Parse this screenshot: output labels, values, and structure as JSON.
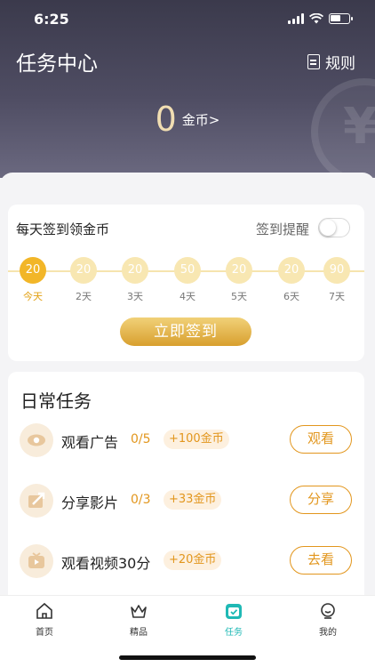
{
  "status": {
    "time": "6:25"
  },
  "header": {
    "title": "任务中心",
    "rules_label": "规则"
  },
  "balance": {
    "value": "0",
    "unit": "金币>"
  },
  "checkin": {
    "title": "每天签到领金币",
    "reminder_label": "签到提醒",
    "reminder_enabled": false,
    "days": [
      {
        "coins": "20",
        "label": "今天",
        "active": true
      },
      {
        "coins": "20",
        "label": "2天"
      },
      {
        "coins": "20",
        "label": "3天"
      },
      {
        "coins": "50",
        "label": "4天"
      },
      {
        "coins": "20",
        "label": "5天"
      },
      {
        "coins": "20",
        "label": "6天"
      },
      {
        "coins": "90",
        "label": "7天"
      }
    ],
    "button_label": "立即签到"
  },
  "daily": {
    "title": "日常任务",
    "tasks": [
      {
        "icon": "eye-icon",
        "name": "观看广告",
        "progress": "0/5",
        "reward": "+100金币",
        "action": "观看"
      },
      {
        "icon": "share-icon",
        "name": "分享影片",
        "progress": "0/3",
        "reward": "+33金币",
        "action": "分享"
      },
      {
        "icon": "tv-icon",
        "name": "观看视频30分",
        "progress": "",
        "reward": "+20金币",
        "action": "去看"
      }
    ]
  },
  "tabs": [
    {
      "icon": "home-icon",
      "label": "首页"
    },
    {
      "icon": "crown-icon",
      "label": "精品"
    },
    {
      "icon": "task-icon",
      "label": "任务",
      "active": true
    },
    {
      "icon": "profile-icon",
      "label": "我的"
    }
  ],
  "colors": {
    "accent": "#e2961d",
    "gold": "#f2b628",
    "tab_active": "#1fb9b5",
    "header": "#3b3a4c"
  }
}
